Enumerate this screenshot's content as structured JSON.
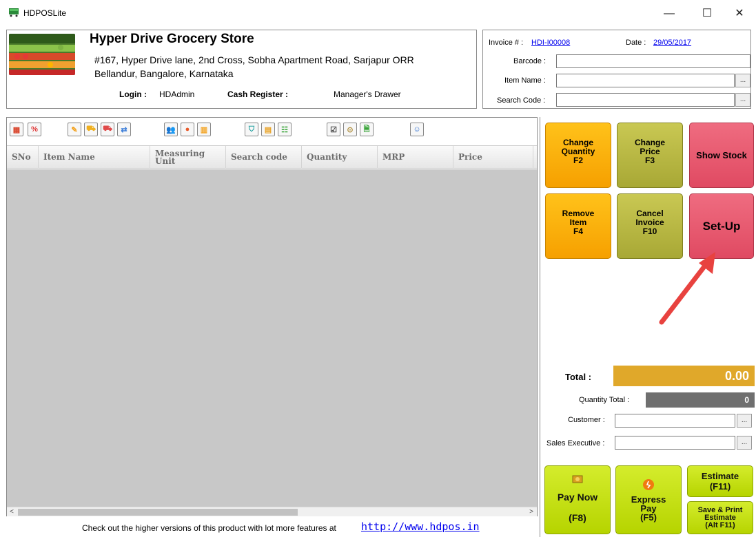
{
  "window": {
    "title": "HDPOSLite",
    "minimize": "—",
    "maximize": "☐",
    "close": "✕"
  },
  "store": {
    "name": "Hyper Drive Grocery Store",
    "address_line1": "#167, Hyper Drive lane, 2nd Cross, Sobha Apartment Road, Sarjapur ORR",
    "address_line2": "Bellandur, Bangalore, Karnataka",
    "login_label": "Login :",
    "login_value": "HDAdmin",
    "cash_register_label": "Cash Register :",
    "cash_register_value": "Manager's Drawer"
  },
  "invoice": {
    "invoice_label": "Invoice # :",
    "invoice_number": "HDI-I00008",
    "date_label": "Date :",
    "date_value": "29/05/2017",
    "barcode_label": "Barcode :",
    "item_name_label": "Item Name :",
    "search_code_label": "Search Code :",
    "browse_label": "..."
  },
  "grid": {
    "columns": [
      "SNo",
      "Item Name",
      "Measuring Unit",
      "Search code",
      "Quantity",
      "MRP",
      "Price"
    ],
    "rows": [],
    "scroll_left": "<",
    "scroll_right": ">"
  },
  "toolbar_icons": [
    {
      "name": "calculator-icon",
      "glyph": "▦",
      "color": "#d9442b"
    },
    {
      "name": "discount-icon",
      "glyph": "%",
      "color": "#e03a3a"
    },
    {
      "name": "edit-note-icon",
      "glyph": "✎",
      "color": "#f3a21f"
    },
    {
      "name": "cart-icon",
      "glyph": "⛟",
      "color": "#f0b020"
    },
    {
      "name": "truck-icon",
      "glyph": "⛟",
      "color": "#e04a4a"
    },
    {
      "name": "transfer-icon",
      "glyph": "⇄",
      "color": "#3b7dd8"
    },
    {
      "name": "customers-icon",
      "glyph": "👥",
      "color": "#9ab82a"
    },
    {
      "name": "user-icon",
      "glyph": "●",
      "color": "#e85a2a"
    },
    {
      "name": "factory-icon",
      "glyph": "▥",
      "color": "#f3a21f"
    },
    {
      "name": "basket-icon",
      "glyph": "⛉",
      "color": "#20a0a0"
    },
    {
      "name": "inventory-icon",
      "glyph": "▤",
      "color": "#e8a020"
    },
    {
      "name": "hierarchy-icon",
      "glyph": "☷",
      "color": "#30a030"
    },
    {
      "name": "checklist-icon",
      "glyph": "☑",
      "color": "#404040"
    },
    {
      "name": "money-icon",
      "glyph": "⊙",
      "color": "#b09040"
    },
    {
      "name": "document-icon",
      "glyph": "🗎",
      "color": "#30a030"
    },
    {
      "name": "person-icon",
      "glyph": "☺",
      "color": "#3070d0"
    }
  ],
  "actions": {
    "change_quantity": [
      "Change",
      "Quantity",
      "F2"
    ],
    "change_price": [
      "Change",
      "Price",
      "F3"
    ],
    "show_stock": "Show Stock",
    "remove_item": [
      "Remove",
      "Item",
      "F4"
    ],
    "cancel_invoice": [
      "Cancel",
      "Invoice",
      "F10"
    ],
    "setup": "Set-Up",
    "pay_now": [
      "Pay Now",
      "(F8)"
    ],
    "express_pay": [
      "Express",
      "Pay",
      "(F5)"
    ],
    "estimate": [
      "Estimate",
      "(F11)"
    ],
    "save_print_estimate": [
      "Save & Print",
      "Estimate",
      "(Alt F11)"
    ]
  },
  "totals": {
    "total_label": "Total :",
    "total_value": "0.00",
    "quantity_total_label": "Quantity Total :",
    "quantity_total_value": "0",
    "customer_label": "Customer :",
    "sales_executive_label": "Sales Executive :"
  },
  "footer": {
    "text": "Check out the higher versions of this product with lot more features at",
    "link": "http://www.hdpos.in"
  },
  "colors": {
    "orange": "#f6a000",
    "olive": "#a8a835",
    "pink": "#e04a62",
    "lime": "#b6d400",
    "total_bar": "#e0a82a",
    "qty_bar": "#6f6f6f",
    "annotation_arrow": "#e8423f"
  }
}
